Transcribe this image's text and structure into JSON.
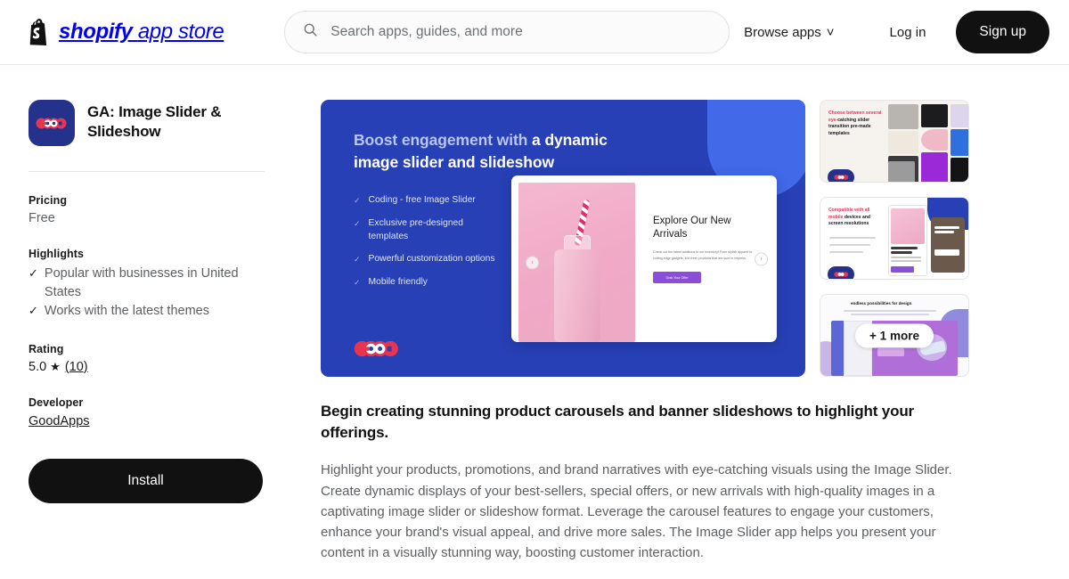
{
  "header": {
    "logo_brand": "shopify",
    "logo_suffix": "app store",
    "logo_icon": "shopify-bag-icon",
    "search": {
      "placeholder": "Search apps, guides, and more",
      "value": "",
      "icon": "search-icon"
    },
    "browse_apps": "Browse apps",
    "browse_chevron": "˅",
    "login": "Log in",
    "signup": "Sign up"
  },
  "sidebar": {
    "app_title": "GA: Image Slider & Slideshow",
    "app_icon_label": "GOOD",
    "pricing_label": "Pricing",
    "pricing_value": "Free",
    "highlights_label": "Highlights",
    "highlights": [
      "Popular with businesses in United States",
      "Works with the latest themes"
    ],
    "check_glyph": "✓",
    "rating_label": "Rating",
    "rating_value": "5.0",
    "rating_star": "★",
    "rating_count": "(10)",
    "developer_label": "Developer",
    "developer_name": "GoodApps",
    "install_label": "Install"
  },
  "hero": {
    "headline_dim": "Boost engagement with ",
    "headline_bright": "a dynamic image slider and slideshow",
    "bullets": [
      "Coding - free Image Slider",
      "Exclusive pre-designed templates",
      "Powerful customization options",
      "Mobile friendly"
    ],
    "tick_glyph": "✓",
    "brand_logo": "GOOD",
    "mockup": {
      "heading": "Explore Our New Arrivals",
      "body": "Check out the latest additions to our inventory! From stylish apparel to cutting-edge gadgets, find fresh products that are sure to impress.",
      "cta": "Grab Your Offer",
      "prev_arrow": "‹",
      "next_arrow": "›"
    },
    "accent_blue": "#2740b5",
    "accent_light_blue": "#4169e8"
  },
  "thumbnails": [
    {
      "name": "thumbnail-templates",
      "title_colored": "Choose between several eye-",
      "title_plain": "catching slider transition pre-made templates"
    },
    {
      "name": "thumbnail-mobile",
      "title_colored": "Compatible with all mobile ",
      "title_plain": "devices and screen resolutions"
    },
    {
      "name": "thumbnail-design",
      "title_colored": "endless possibilities",
      "title_plain": " for design",
      "overlay": "+ 1 more"
    }
  ],
  "description": {
    "heading": "Begin creating stunning product carousels and banner slideshows to highlight your offerings.",
    "body": "Highlight your products, promotions, and brand narratives with eye-catching visuals using the Image Slider. Create dynamic displays of your best-sellers, special offers, or new arrivals with high-quality images in a captivating image slider or slideshow format. Leverage the carousel features to engage your customers, enhance your brand's visual appeal, and drive more sales. The Image Slider app helps you present your content in a visually stunning way, boosting customer interaction."
  }
}
